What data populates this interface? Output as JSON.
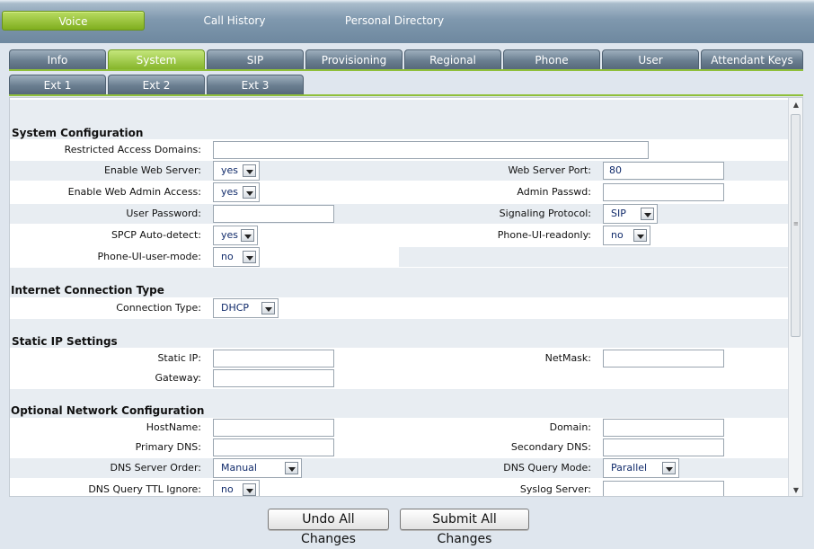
{
  "top_nav": [
    {
      "label": "Voice",
      "active": true
    },
    {
      "label": "Call History",
      "active": false
    },
    {
      "label": "Personal Directory",
      "active": false
    }
  ],
  "tabs_row1": [
    {
      "label": "Info",
      "active": false
    },
    {
      "label": "System",
      "active": true
    },
    {
      "label": "SIP",
      "active": false
    },
    {
      "label": "Provisioning",
      "active": false
    },
    {
      "label": "Regional",
      "active": false
    },
    {
      "label": "Phone",
      "active": false
    },
    {
      "label": "User",
      "active": false
    },
    {
      "label": "Attendant Keys",
      "active": false
    }
  ],
  "tabs_row2": [
    {
      "label": "Ext 1"
    },
    {
      "label": "Ext 2"
    },
    {
      "label": "Ext 3"
    }
  ],
  "sections": {
    "system_configuration": "System Configuration",
    "internet_connection_type": "Internet Connection Type",
    "static_ip_settings": "Static IP Settings",
    "optional_network_configuration": "Optional Network Configuration"
  },
  "fields": {
    "restricted_access_domains": {
      "label": "Restricted Access Domains:",
      "value": ""
    },
    "enable_web_server": {
      "label": "Enable Web Server:",
      "value": "yes"
    },
    "web_server_port": {
      "label": "Web Server Port:",
      "value": "80"
    },
    "enable_web_admin_access": {
      "label": "Enable Web Admin Access:",
      "value": "yes"
    },
    "admin_passwd": {
      "label": "Admin Passwd:",
      "value": ""
    },
    "user_password": {
      "label": "User Password:",
      "value": ""
    },
    "signaling_protocol": {
      "label": "Signaling Protocol:",
      "value": "SIP"
    },
    "spcp_auto_detect": {
      "label": "SPCP Auto-detect:",
      "value": "yes"
    },
    "phone_ui_readonly": {
      "label": "Phone-UI-readonly:",
      "value": "no"
    },
    "phone_ui_user_mode": {
      "label": "Phone-UI-user-mode:",
      "value": "no"
    },
    "connection_type": {
      "label": "Connection Type:",
      "value": "DHCP"
    },
    "static_ip": {
      "label": "Static IP:",
      "value": ""
    },
    "netmask": {
      "label": "NetMask:",
      "value": ""
    },
    "gateway": {
      "label": "Gateway:",
      "value": ""
    },
    "hostname": {
      "label": "HostName:",
      "value": ""
    },
    "domain": {
      "label": "Domain:",
      "value": ""
    },
    "primary_dns": {
      "label": "Primary DNS:",
      "value": ""
    },
    "secondary_dns": {
      "label": "Secondary DNS:",
      "value": ""
    },
    "dns_server_order": {
      "label": "DNS Server Order:",
      "value": "Manual"
    },
    "dns_query_mode": {
      "label": "DNS Query Mode:",
      "value": "Parallel"
    },
    "dns_query_ttl_ignore": {
      "label": "DNS Query TTL Ignore:",
      "value": "no"
    },
    "syslog_server": {
      "label": "Syslog Server:",
      "value": ""
    }
  },
  "buttons": {
    "undo": "Undo All Changes",
    "submit": "Submit All Changes"
  },
  "colors": {
    "active_tab": "#86b52a",
    "tab": "#6a7e90",
    "row_shade": "#e8edf2",
    "field_text": "#102a6a"
  }
}
